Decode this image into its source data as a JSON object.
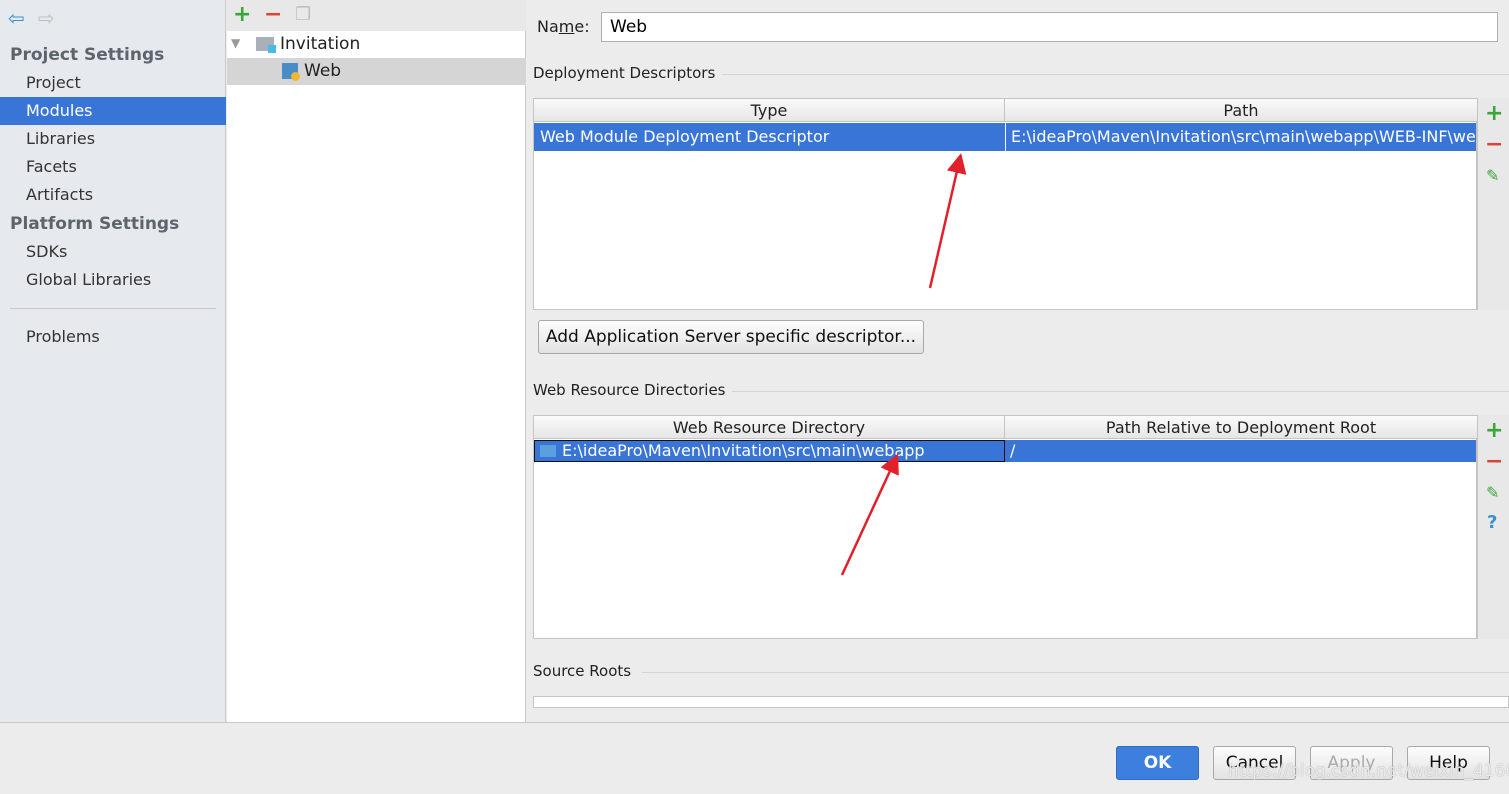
{
  "sidebar": {
    "back_icon": "arrow-left-icon",
    "forward_icon": "arrow-right-icon",
    "project_settings": "Project Settings",
    "items1": [
      "Project",
      "Modules",
      "Libraries",
      "Facets",
      "Artifacts"
    ],
    "platform_settings": "Platform Settings",
    "items2": [
      "SDKs",
      "Global Libraries"
    ],
    "problems": "Problems",
    "selected": "Modules"
  },
  "tree": {
    "root": "Invitation",
    "child": "Web"
  },
  "name": {
    "label_pre": "Na",
    "label_u": "m",
    "label_post": "e:",
    "value": "Web"
  },
  "deployment": {
    "title": "Deployment Descriptors",
    "columns": [
      "Type",
      "Path"
    ],
    "rows": [
      [
        "Web Module Deployment Descriptor",
        "E:\\ideaPro\\Maven\\Invitation\\src\\main\\webapp\\WEB-INF\\web.xml"
      ]
    ],
    "add_button": "Add Application Server specific descriptor..."
  },
  "web_resources": {
    "title": "Web Resource Directories",
    "columns": [
      "Web Resource Directory",
      "Path Relative to Deployment Root"
    ],
    "rows": [
      [
        "E:\\ideaPro\\Maven\\Invitation\\src\\main\\webapp",
        "/"
      ]
    ]
  },
  "source_roots": {
    "title": "Source Roots"
  },
  "buttons": {
    "ok": "OK",
    "cancel": "Cancel",
    "apply": "Apply",
    "help": "Help"
  },
  "colors": {
    "selection": "#3875d7",
    "annotation_arrow": "#e0202a"
  },
  "watermark": "https://blog.csdn.net/weixin_41660948"
}
